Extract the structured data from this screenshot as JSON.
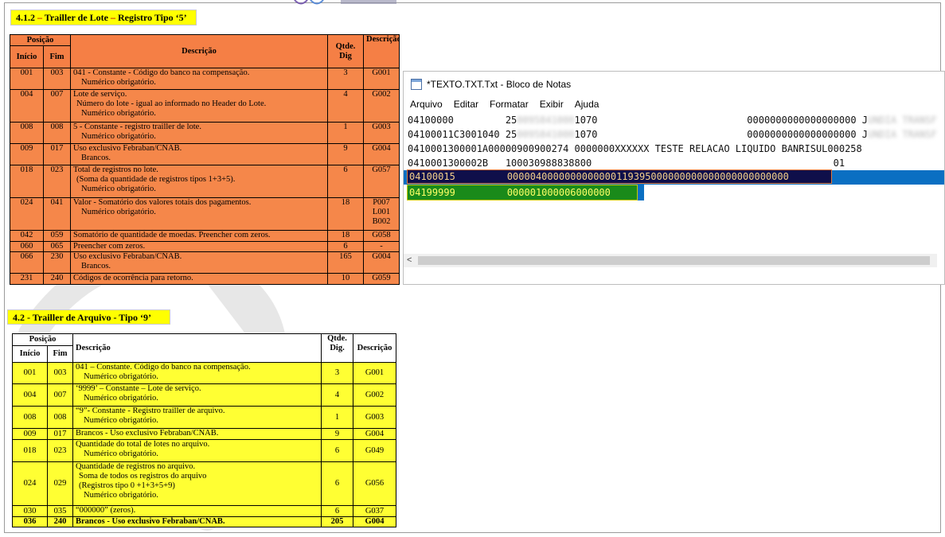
{
  "section1": {
    "title_prefix": "4.1.2 ",
    "title_dash1": "–",
    "title_mid": " Trailler de Lote ",
    "title_dash2": "–",
    "title_rest": " Registro Tipo ‘5’",
    "headers": {
      "posicao": "Posição",
      "inicio": "Início",
      "fim": "Fim",
      "descricao": "Descrição",
      "qtde": "Qtde. Dig",
      "descricao2": "Descrição"
    },
    "rows": [
      {
        "inicio": "001",
        "fim": "003",
        "lines": [
          "041 - Constante - Código do banco na compensação.",
          "Numérico obrigatório."
        ],
        "qtde": "3",
        "ref": "G001"
      },
      {
        "inicio": "004",
        "fim": "007",
        "lines": [
          "Lote de serviço.",
          "Número do lote - igual ao informado no Header do Lote.",
          "Numérico obrigatório."
        ],
        "qtde": "4",
        "ref": "G002"
      },
      {
        "inicio": "008",
        "fim": "008",
        "lines": [
          "5 - Constante - registro trailler de lote.",
          "Numérico obrigatório."
        ],
        "qtde": "1",
        "ref": "G003"
      },
      {
        "inicio": "009",
        "fim": "017",
        "lines": [
          "Uso exclusivo Febraban/CNAB.",
          "Brancos."
        ],
        "qtde": "9",
        "ref": "G004"
      },
      {
        "inicio": "018",
        "fim": "023",
        "lines": [
          "Total de registros no lote.",
          "(Soma da quantidade de registros tipos 1+3+5).",
          "Numérico obrigatório."
        ],
        "qtde": "6",
        "ref": "G057"
      },
      {
        "inicio": "024",
        "fim": "041",
        "lines": [
          "Valor - Somatório dos valores totais dos pagamentos.",
          "Numérico obrigatório."
        ],
        "qtde": "18",
        "ref": "P007",
        "ref2": "L001",
        "ref3": "B002"
      },
      {
        "inicio": "042",
        "fim": "059",
        "lines": [
          "Somatório de quantidade de moedas. Preencher com zeros."
        ],
        "qtde": "18",
        "ref": "G058"
      },
      {
        "inicio": "060",
        "fim": "065",
        "lines": [
          "Preencher com zeros."
        ],
        "qtde": "6",
        "ref": "-"
      },
      {
        "inicio": "066",
        "fim": "230",
        "lines": [
          "Uso exclusivo Febraban/CNAB.",
          "Brancos."
        ],
        "qtde": "165",
        "ref": "G004"
      },
      {
        "inicio": "231",
        "fim": "240",
        "lines": [
          "Códigos de ocorrência para retorno."
        ],
        "qtde": "10",
        "ref": "G059"
      }
    ]
  },
  "section2": {
    "title": "4.2 - Trailler de Arquivo - Tipo ‘9’",
    "headers": {
      "posicao": "Posição",
      "inicio": "Início",
      "fim": "Fim",
      "descricao": "Descrição",
      "qtde": "Qtde. Dig.",
      "descricao2": "Descrição"
    },
    "rows": [
      {
        "inicio": "001",
        "fim": "003",
        "lines": [
          "041 – Constante.  Código do banco na compensação.",
          "Numérico obrigatório."
        ],
        "qtde": "3",
        "ref": "G001"
      },
      {
        "inicio": "004",
        "fim": "007",
        "lines": [
          "‘9999’ – Constante – Lote de serviço.",
          "Numérico obrigatório."
        ],
        "qtde": "4",
        "ref": "G002"
      },
      {
        "inicio": "008",
        "fim": "008",
        "lines": [
          "“9”- Constante - Registro trailler de arquivo.",
          "Numérico obrigatório."
        ],
        "qtde": "1",
        "ref": "G003"
      },
      {
        "inicio": "009",
        "fim": "017",
        "lines": [
          "Brancos - Uso exclusivo Febraban/CNAB."
        ],
        "qtde": "9",
        "ref": "G004"
      },
      {
        "inicio": "018",
        "fim": "023",
        "lines": [
          "Quantidade do total de lotes no arquivo.",
          "Numérico obrigatório."
        ],
        "qtde": "6",
        "ref": "G049"
      },
      {
        "inicio": "024",
        "fim": "029",
        "lines": [
          "Quantidade de registros no arquivo.",
          "Soma de todos os registros do arquivo",
          "(Registros tipo 0 +1+3+5+9)",
          "Numérico obrigatório."
        ],
        "qtde": "6",
        "ref": "G056"
      },
      {
        "inicio": "030",
        "fim": "035",
        "lines": [
          "“000000” (zeros)."
        ],
        "qtde": "6",
        "ref": "G037"
      },
      {
        "inicio": "036",
        "fim": "240",
        "lines": [
          "Brancos - Uso exclusivo Febraban/CNAB."
        ],
        "qtde": "205",
        "ref": "G004"
      }
    ]
  },
  "notepad": {
    "title": "*TEXTO.TXT.Txt - Bloco de Notas",
    "menu": [
      "Arquivo",
      "Editar",
      "Formatar",
      "Exibir",
      "Ajuda"
    ],
    "lines": [
      {
        "a": "04100000         25",
        "blur": "0095841000",
        "b": "1070                          0000000000000000000 J",
        "blur2": "UNDIA TRANSF"
      },
      {
        "a": "04100011C3001040 25",
        "blur": "0095841000",
        "b": "1070                          0000000000000000000 J",
        "blur2": "UNDIA TRANSF"
      },
      {
        "a": "0410001300001A00000900900274 0000000XXXXXX TESTE RELACAO LIQUIDO BANRISUL000258"
      },
      {
        "a": "0410001300002B   100030988838800                                          01"
      }
    ],
    "highlight_lote": "04100015         0000040000000000000119395000000000000000000000000",
    "highlight_arquivo": "04199999         000001000006000000",
    "scroll_left_arrow": "<"
  },
  "colors": {
    "orange": "#f5874a",
    "yellow": "#ffff33",
    "selection": "#0a6fc2",
    "dark_highlight": "#0f0f4a",
    "green_highlight": "#1a8a1a"
  }
}
